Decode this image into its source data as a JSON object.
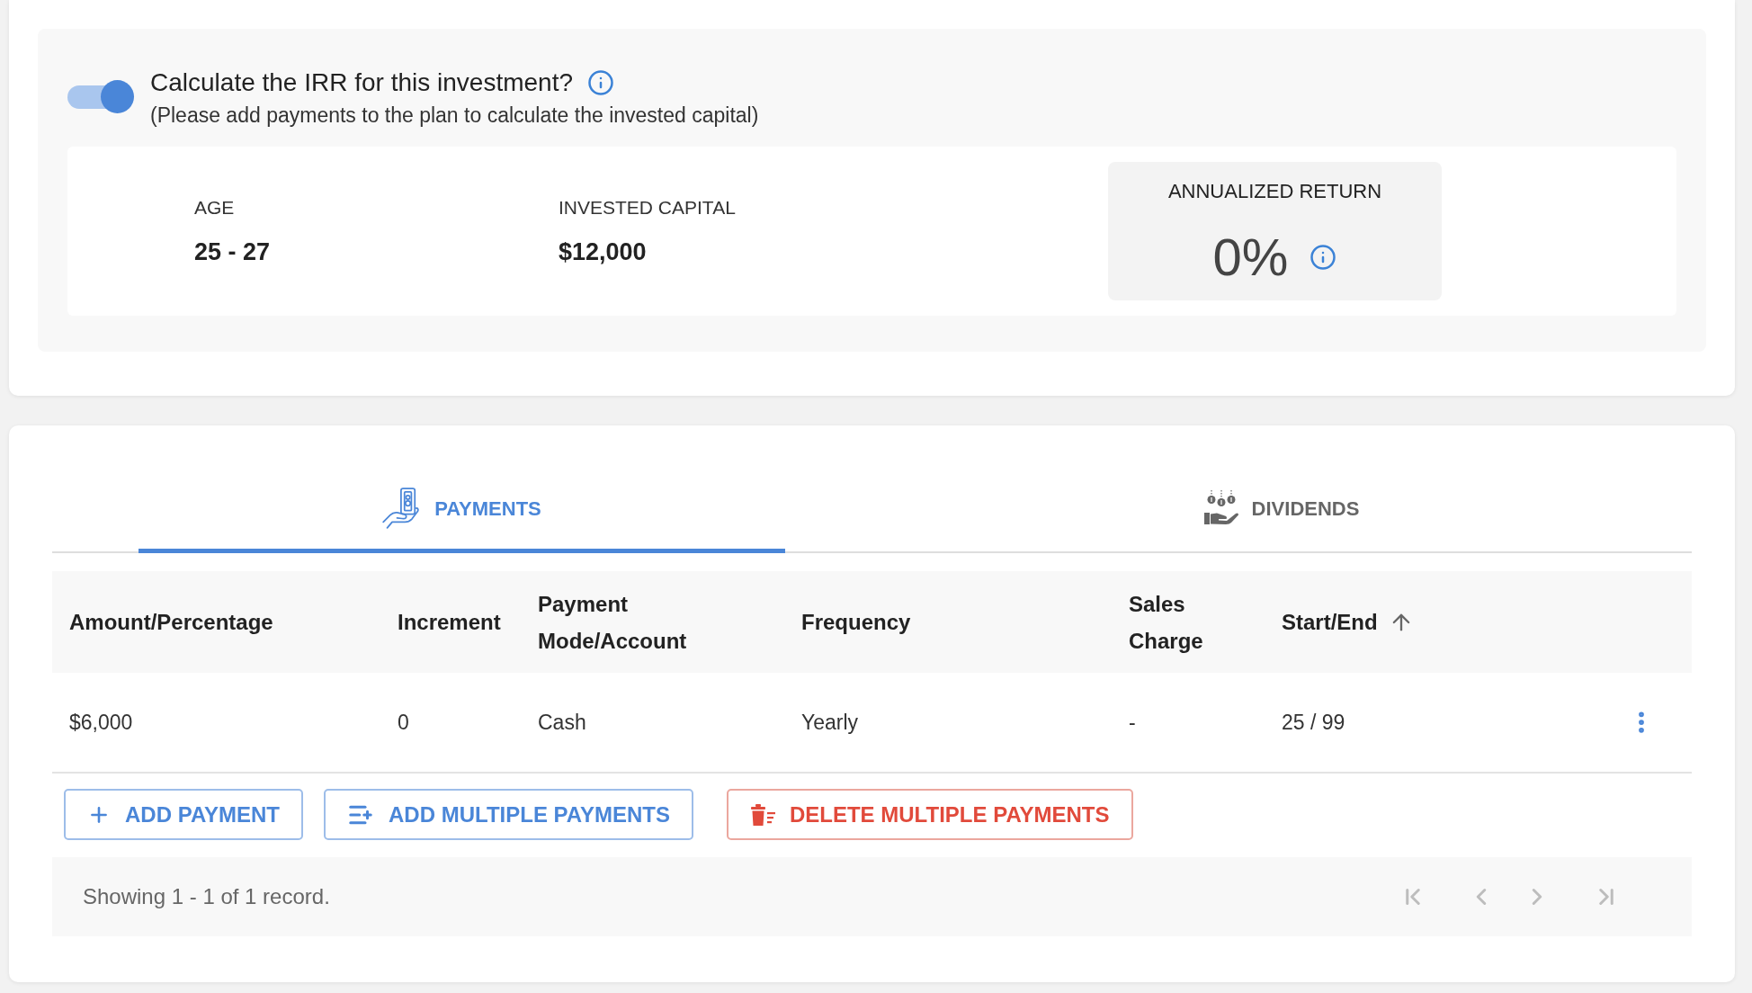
{
  "irr": {
    "toggle": {
      "on": true
    },
    "title": "Calculate the IRR for this investment?",
    "subtitle": "(Please add payments to the plan to calculate the invested capital)"
  },
  "summary": {
    "stats": [
      {
        "label": "AGE",
        "value": "25 - 27"
      },
      {
        "label": "INVESTED CAPITAL",
        "value": "$12,000"
      }
    ],
    "annualized_return": {
      "label": "ANNUALIZED RETURN",
      "value": "0%"
    }
  },
  "tabs": [
    {
      "label": "PAYMENTS",
      "kind": "payments",
      "selected": true
    },
    {
      "label": "DIVIDENDS",
      "kind": "dividends",
      "selected": false
    }
  ],
  "table": {
    "columns": [
      {
        "label": "Amount/Percentage",
        "sorted": false
      },
      {
        "label": "Increment",
        "sorted": false
      },
      {
        "label": "Payment Mode/Account",
        "sorted": false
      },
      {
        "label": "Frequency",
        "sorted": false
      },
      {
        "label": "Sales Charge",
        "sorted": false
      },
      {
        "label": "Start/End",
        "sorted": true
      }
    ],
    "rows": [
      {
        "cells": [
          "$6,000",
          "0",
          "Cash",
          "Yearly",
          "-",
          "25 / 99"
        ]
      }
    ]
  },
  "actions": [
    {
      "label": "ADD PAYMENT",
      "kind": "add"
    },
    {
      "label": "ADD MULTIPLE PAYMENTS",
      "kind": "add_multiple"
    },
    {
      "label": "DELETE MULTIPLE PAYMENTS",
      "kind": "delete"
    }
  ],
  "footer": {
    "status": "Showing 1 - 1 of 1 record.",
    "pagination": [
      {
        "kind": "first",
        "disabled": true
      },
      {
        "kind": "previous",
        "disabled": true
      },
      {
        "kind": "next",
        "disabled": true
      },
      {
        "kind": "last",
        "disabled": true
      }
    ]
  }
}
